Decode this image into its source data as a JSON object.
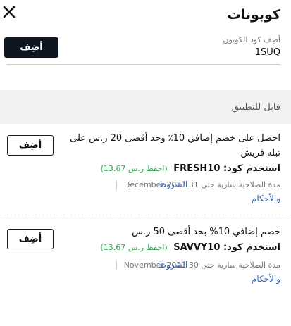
{
  "header": {
    "title": "كوبونات",
    "close_icon": "close-icon"
  },
  "coupon_form": {
    "label": "أضِف كود الكوبون",
    "value": "1SUQ",
    "add_label": "أضِف"
  },
  "section": {
    "title": "قابل للتطبيق"
  },
  "offers": [
    {
      "description": "احصل على خصم إضافي 10٪ وحد أقصى 20 ر.س على تبله فريش",
      "code_prefix": "استخدم كود:",
      "code": "FRESH10",
      "save_note": "(احفظ ر.س 13.67)",
      "validity": "مدة الصلاحية سارية حتى 31 December 2021",
      "terms_first": "الشروط",
      "terms_second": "والأحكام",
      "add_label": "أضِف"
    },
    {
      "description": "خصم إضافي 10% بحد أقصى 50 ر.س",
      "code_prefix": "استخدم كود:",
      "code": "SAVVY10",
      "save_note": "(احفظ ر.س 13.67)",
      "validity": "مدة الصلاحية سارية حتى 30 November 2021",
      "terms_first": "الشروط",
      "terms_second": "والأحكام",
      "add_label": "أضِف"
    }
  ],
  "colors": {
    "primary_button": "#0e1721",
    "save_green": "#33a852",
    "link_blue": "#3866a8",
    "section_bg": "#f2f2f2"
  }
}
